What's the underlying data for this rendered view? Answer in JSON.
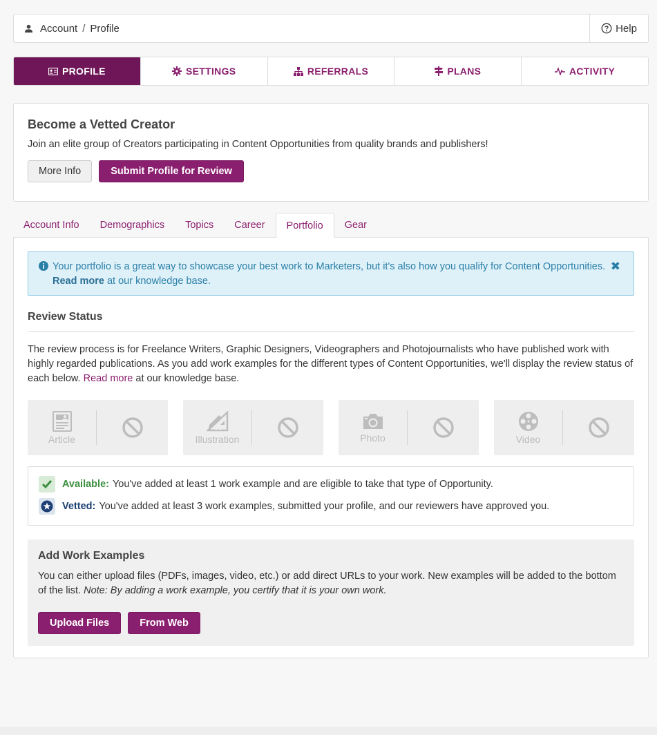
{
  "breadcrumb": {
    "account": "Account",
    "separator": "/",
    "profile": "Profile"
  },
  "help": {
    "label": "Help"
  },
  "main_nav": [
    {
      "label": "PROFILE",
      "icon": "id-card-icon",
      "active": true
    },
    {
      "label": "SETTINGS",
      "icon": "gear-icon",
      "active": false
    },
    {
      "label": "REFERRALS",
      "icon": "sitemap-icon",
      "active": false
    },
    {
      "label": "PLANS",
      "icon": "signpost-icon",
      "active": false
    },
    {
      "label": "ACTIVITY",
      "icon": "pulse-icon",
      "active": false
    }
  ],
  "vetted": {
    "title": "Become a Vetted Creator",
    "description": "Join an elite group of Creators participating in Content Opportunities from quality brands and publishers!",
    "more_info": "More Info",
    "submit": "Submit Profile for Review"
  },
  "sub_tabs": [
    {
      "label": "Account Info",
      "active": false
    },
    {
      "label": "Demographics",
      "active": false
    },
    {
      "label": "Topics",
      "active": false
    },
    {
      "label": "Career",
      "active": false
    },
    {
      "label": "Portfolio",
      "active": true
    },
    {
      "label": "Gear",
      "active": false
    }
  ],
  "alert": {
    "text": "Your portfolio is a great way to showcase your best work to Marketers, but it's also how you qualify for Content Opportunities.",
    "link": "Read more",
    "suffix": "at our knowledge base.",
    "close": "✖"
  },
  "review": {
    "title": "Review Status",
    "description": "The review process is for Freelance Writers, Graphic Designers, Videographers and Photojournalists who have published work with highly regarded publications. As you add work examples for the different types of Content Opportunities, we'll display the review status of each below.",
    "link": "Read more",
    "suffix": "at our knowledge base.",
    "types": [
      {
        "label": "Article",
        "icon": "newspaper-icon"
      },
      {
        "label": "Illustration",
        "icon": "pencil-ruler-icon"
      },
      {
        "label": "Photo",
        "icon": "camera-icon"
      },
      {
        "label": "Video",
        "icon": "film-reel-icon"
      }
    ]
  },
  "legend": {
    "available_key": "Available:",
    "available_text": "You've added at least 1 work example and are eligible to take that type of Opportunity.",
    "vetted_key": "Vetted:",
    "vetted_text": "You've added at least 3 work examples, submitted your profile, and our reviewers have approved you."
  },
  "add_examples": {
    "title": "Add Work Examples",
    "description": "You can either upload files (PDFs, images, video, etc.) or add direct URLs to your work. New examples will be added to the bottom of the list.",
    "note": "Note: By adding a work example, you certify that it is your own work.",
    "upload": "Upload Files",
    "from_web": "From Web"
  },
  "colors": {
    "brand": "#8b1f6f",
    "brand_dark": "#6e1657",
    "info_bg": "#dff1f8",
    "info_text": "#2a7fa8",
    "available_green": "#3c8f3f",
    "vetted_blue": "#1d3f73"
  }
}
